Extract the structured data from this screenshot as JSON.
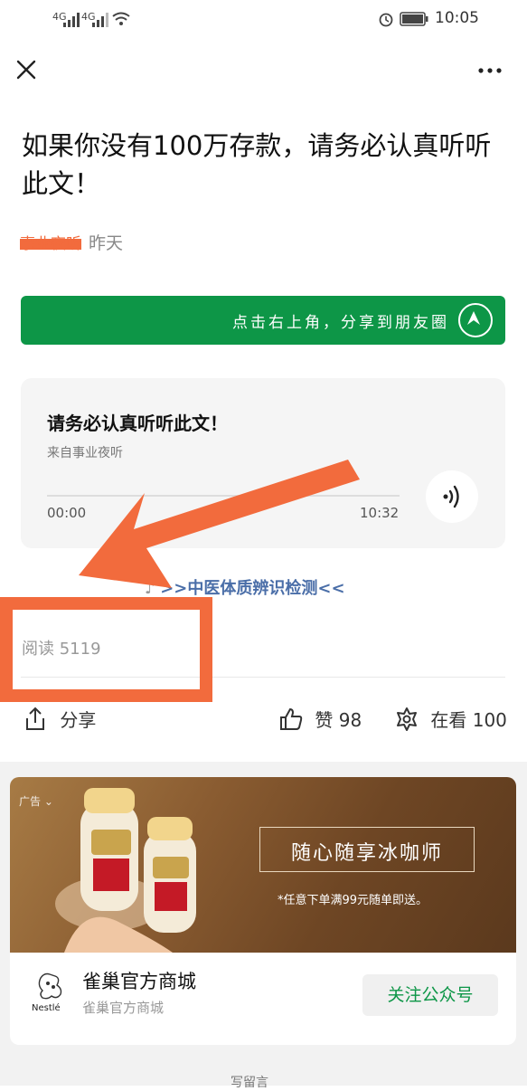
{
  "status_bar": {
    "time": "10:05",
    "net1": "4G",
    "net2": "4G"
  },
  "article": {
    "title": "如果你没有100万存款，请务必认真听听此文！",
    "author_redacted": "事业夜听",
    "date": "昨天"
  },
  "share_banner": {
    "text": "点击右上角，分享到朋友圈"
  },
  "audio": {
    "title": "请务必认真听听此文！",
    "source": "来自事业夜听",
    "time_start": "00:00",
    "time_end": "10:32"
  },
  "promo_link": {
    "text": ">>中医体质辨识检测<<"
  },
  "stats": {
    "read_label": "阅读 5119"
  },
  "actions": {
    "share": "分享",
    "like": "赞 98",
    "watching": "在看 100"
  },
  "ad": {
    "tag": "广告",
    "slogan": "随心随享冰咖师",
    "subtext": "*任意下单满99元随单即送。",
    "brand_name": "雀巢官方商城",
    "brand_sub": "雀巢官方商城",
    "follow_button": "关注公众号",
    "logo_text": "Nestlé"
  },
  "footer": {
    "partial": "写留言"
  },
  "colors": {
    "green": "#0d9647",
    "annotation_orange": "#f26b3d",
    "link_blue": "#4a6ea8"
  }
}
